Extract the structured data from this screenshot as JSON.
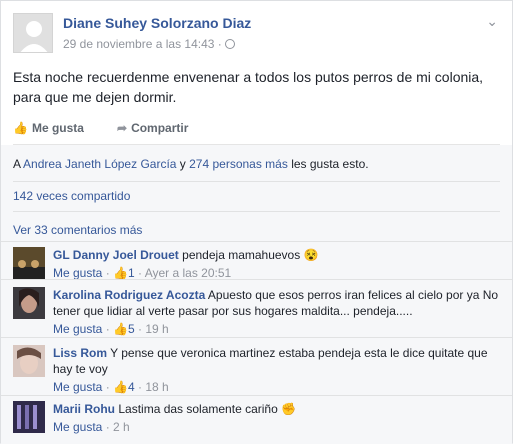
{
  "post": {
    "author": "Diane Suhey Solorzano Diaz",
    "timestamp": "29 de noviembre a las 14:43 ·",
    "text": "Esta noche recuerdenme envenenar a todos los putos perros de mi colonia, para que me dejen dormir.",
    "menu_icon": "chevron-down-icon",
    "privacy_icon": "globe-icon"
  },
  "actions": {
    "like_label": "Me gusta",
    "share_label": "Compartir"
  },
  "likes": {
    "prefix": "A ",
    "name": "Andrea Janeth López García",
    "joiner": " y ",
    "others": "274 personas más",
    "suffix": " les gusta esto."
  },
  "shares_text": "142 veces compartido",
  "more_comments": "Ver 33 comentarios más",
  "comments": [
    {
      "name": "GL Danny Joel Drouet",
      "text": "pendeja mamahuevos 😵",
      "like_label": "Me gusta",
      "sep": "·",
      "likes": "1",
      "time": "Ayer a las 20:51"
    },
    {
      "name": "Karolina Rodriguez Acozta",
      "text": "Apuesto que esos perros iran felices al cielo por ya No tener que lidiar al verte pasar por sus hogares maldita... pendeja.....",
      "like_label": "Me gusta",
      "sep": "·",
      "likes": "5",
      "time": "19 h"
    },
    {
      "name": "Liss Rom",
      "text": "Y pense que veronica martinez estaba pendeja esta le dice quitate que hay te voy",
      "like_label": "Me gusta",
      "sep": "·",
      "likes": "4",
      "time": "18 h"
    },
    {
      "name": "Marii Rohu",
      "text": "Lastima das solamente cariño ✊",
      "like_label": "Me gusta",
      "sep": "·",
      "likes": "",
      "time": "2 h"
    }
  ]
}
